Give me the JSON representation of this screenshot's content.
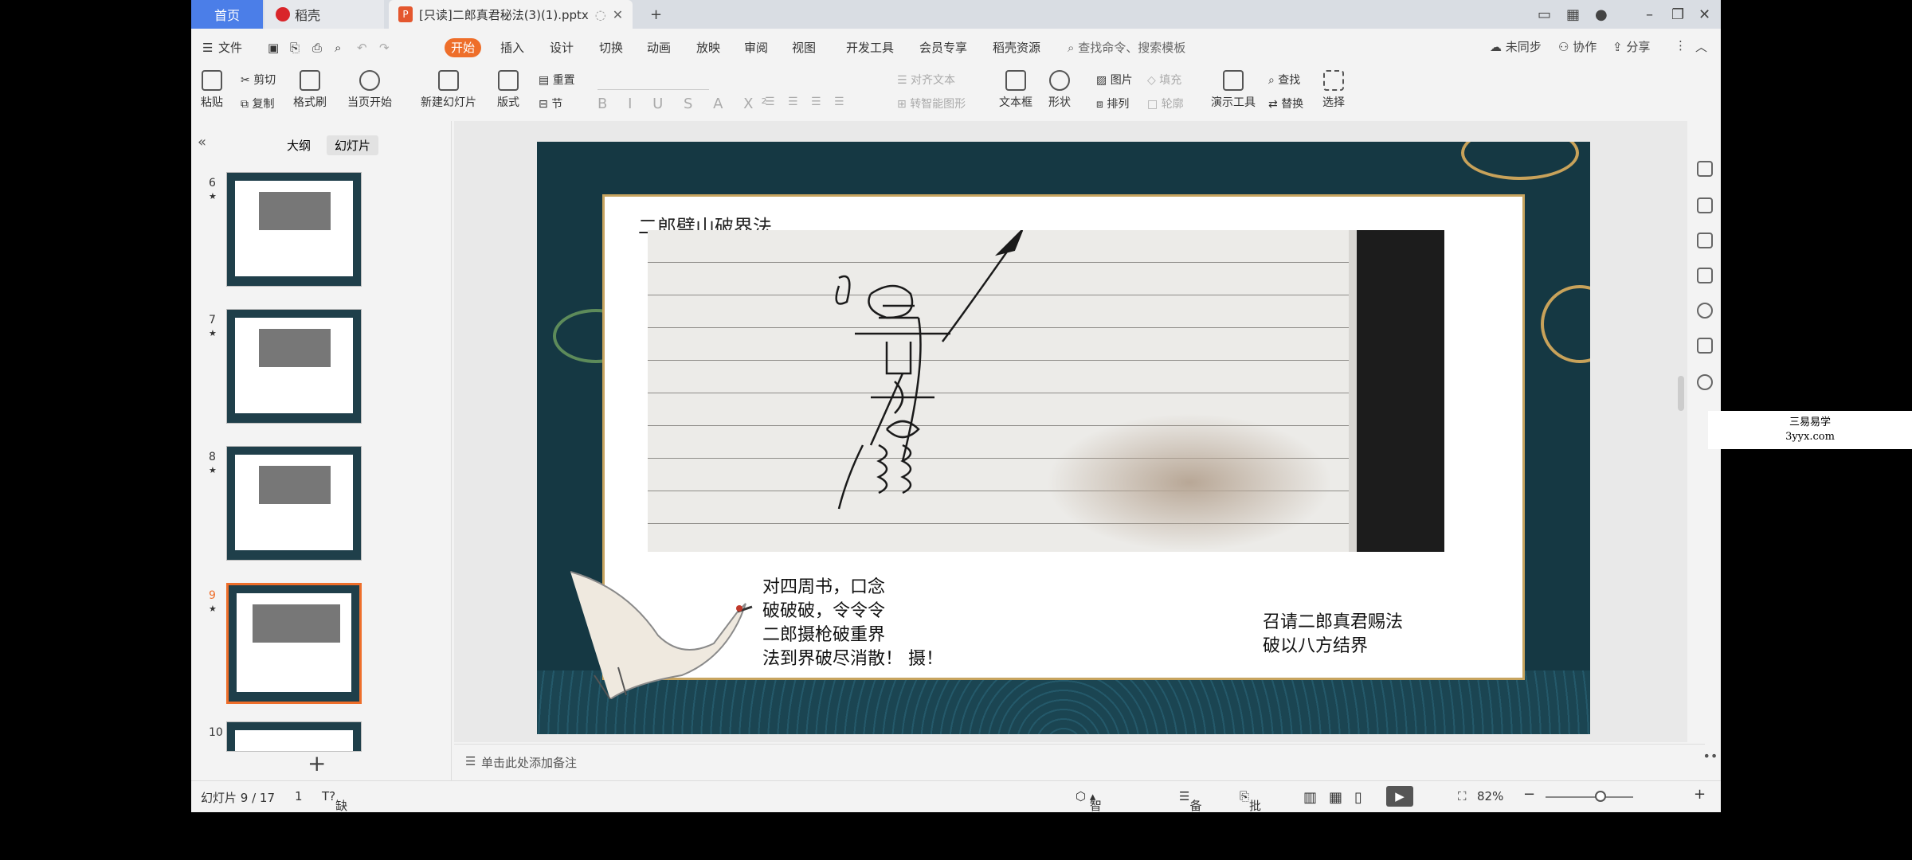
{
  "titlebar": {
    "home_tab": "首页",
    "daoke_tab": "稻壳",
    "doc_tab": "[只读]二郎真君秘法(3)(1).pptx"
  },
  "menu": {
    "file": "文件",
    "items": [
      "开始",
      "插入",
      "设计",
      "切换",
      "动画",
      "放映",
      "审阅",
      "视图",
      "开发工具",
      "会员专享",
      "稻壳资源"
    ],
    "search_placeholder": "查找命令、搜索模板",
    "unsync": "未同步",
    "collab": "协作",
    "share": "分享"
  },
  "ribbon": {
    "paste": "粘贴",
    "cut": "剪切",
    "copy": "复制",
    "format_painter": "格式刷",
    "from_current": "当页开始",
    "new_slide": "新建幻灯片",
    "layout": "版式",
    "reset": "重置",
    "section": "节",
    "align_text": "对齐文本",
    "convert_smart": "转智能图形",
    "textbox": "文本框",
    "shape": "形状",
    "picture": "图片",
    "fill": "填充",
    "arrange": "排列",
    "outline": "轮廓",
    "presenter_tools": "演示工具",
    "find": "查找",
    "replace": "替换",
    "select": "选择"
  },
  "leftpanel": {
    "outline_tab": "大纲",
    "slides_tab": "幻灯片",
    "slide_numbers": [
      "6",
      "7",
      "8",
      "9",
      "10"
    ],
    "star": "★"
  },
  "slide": {
    "title": "二郎劈山破界法",
    "left_text": [
      "对四周书，口念",
      "破破破，令令令",
      "二郎摄枪破重界",
      "法到界破尽消散！ 摄！"
    ],
    "right_text": [
      "召请二郎真君赐法",
      "破以八方结界"
    ]
  },
  "notes": {
    "placeholder": "单击此处添加备注"
  },
  "status": {
    "slide_counter": "幻灯片 9 / 17",
    "number": "1",
    "missing_font": "缺失字体",
    "smart_beautify": "智能美化",
    "notes": "备注",
    "comments": "批注",
    "zoom": "82%"
  },
  "watermark": {
    "line1": "三易易学",
    "line2": "3yyx.com"
  },
  "colors": {
    "accent": "#ee6e2a",
    "home_tab": "#4b7ee8",
    "slide_bg": "#153843",
    "gold": "#c7a45f"
  }
}
